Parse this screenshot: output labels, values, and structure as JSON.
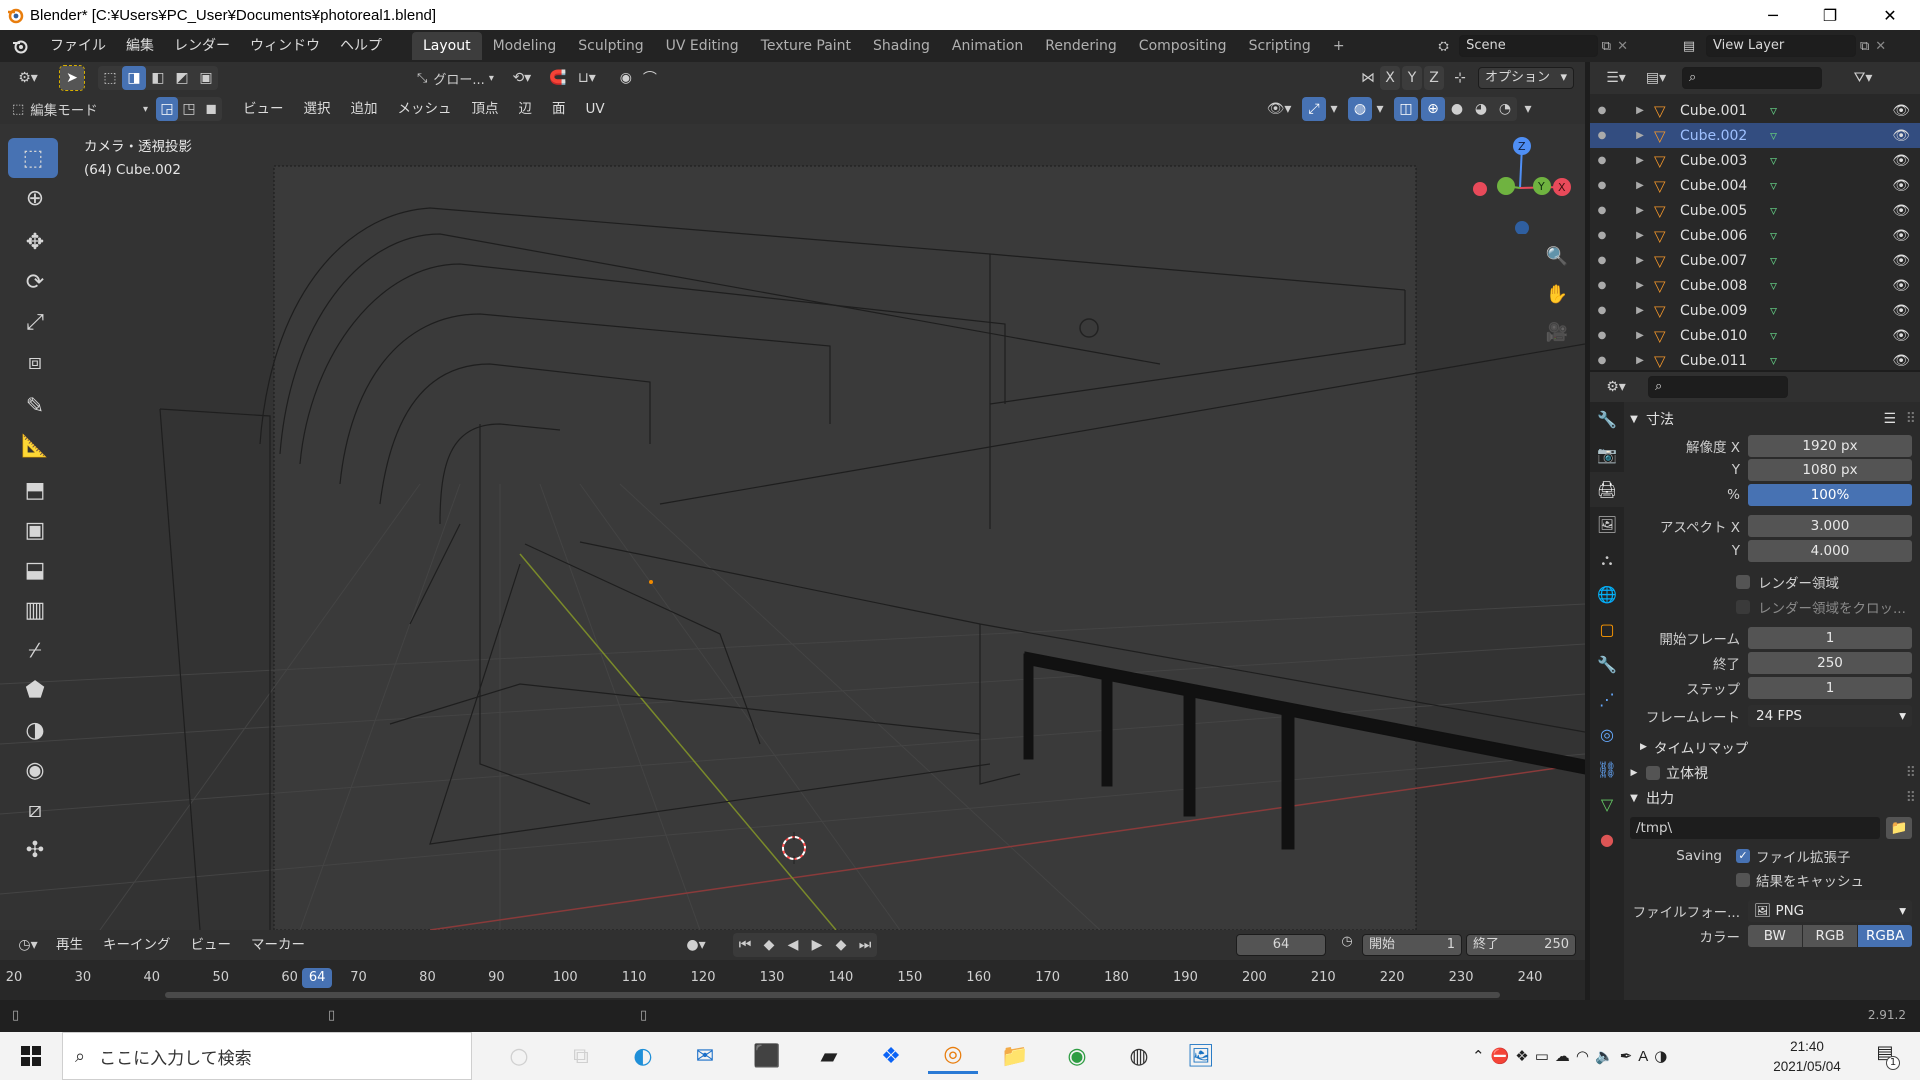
{
  "window": {
    "title": "Blender* [C:¥Users¥PC_User¥Documents¥photoreal1.blend]",
    "minimize": "─",
    "maximize": "❐",
    "close": "✕"
  },
  "menu": [
    "ファイル",
    "編集",
    "レンダー",
    "ウィンドウ",
    "ヘルプ"
  ],
  "workspaces": [
    "Layout",
    "Modeling",
    "Sculpting",
    "UV Editing",
    "Texture Paint",
    "Shading",
    "Animation",
    "Rendering",
    "Compositing",
    "Scripting"
  ],
  "workspace_add": "+",
  "scene": {
    "label": "Scene",
    "view_layer": "View Layer"
  },
  "viewport_header": {
    "transform_orientation": "グロー...",
    "options": "オプション",
    "axis_x": "X",
    "axis_y": "Y",
    "axis_z": "Z",
    "mode": "編集モード",
    "menus": [
      "ビュー",
      "選択",
      "追加",
      "メッシュ",
      "頂点",
      "辺",
      "面",
      "UV"
    ]
  },
  "viewport_info": {
    "line1": "カメラ・透視投影",
    "line2": "(64) Cube.002"
  },
  "gizmo": {
    "x": "X",
    "y": "Y",
    "z": "Z"
  },
  "outliner": {
    "items": [
      {
        "name": "Cube.001",
        "selected": false
      },
      {
        "name": "Cube.002",
        "selected": true
      },
      {
        "name": "Cube.003",
        "selected": false
      },
      {
        "name": "Cube.004",
        "selected": false
      },
      {
        "name": "Cube.005",
        "selected": false
      },
      {
        "name": "Cube.006",
        "selected": false
      },
      {
        "name": "Cube.007",
        "selected": false
      },
      {
        "name": "Cube.008",
        "selected": false
      },
      {
        "name": "Cube.009",
        "selected": false
      },
      {
        "name": "Cube.010",
        "selected": false
      },
      {
        "name": "Cube.011",
        "selected": false
      }
    ]
  },
  "properties": {
    "dimensions_title": "寸法",
    "res_x_label": "解像度 X",
    "res_x": "1920 px",
    "res_y_label": "Y",
    "res_y": "1080 px",
    "res_pct_label": "%",
    "res_pct": "100%",
    "aspect_x_label": "アスペクト X",
    "aspect_x": "3.000",
    "aspect_y_label": "Y",
    "aspect_y": "4.000",
    "render_region": "レンダー領域",
    "crop_region": "レンダー領域をクロッ...",
    "frame_start_label": "開始フレーム",
    "frame_start": "1",
    "frame_end_label": "終了",
    "frame_end": "250",
    "frame_step_label": "ステップ",
    "frame_step": "1",
    "fps_label": "フレームレート",
    "fps": "24 FPS",
    "time_remap": "タイムリマップ",
    "stereoscopy": "立体視",
    "output_title": "出力",
    "output_path": "/tmp\\",
    "saving_label": "Saving",
    "file_ext": "ファイル拡張子",
    "cache_result": "結果をキャッシュ",
    "file_format_label": "ファイルフォー...",
    "file_format": "PNG",
    "color_label": "カラー",
    "color_bw": "BW",
    "color_rgb": "RGB",
    "color_rgba": "RGBA"
  },
  "timeline": {
    "menus": [
      "再生",
      "キーイング",
      "ビュー",
      "マーカー"
    ],
    "current_frame": "64",
    "start_label": "開始",
    "start": "1",
    "end_label": "終了",
    "end": "250",
    "ticks": [
      "20",
      "30",
      "40",
      "50",
      "60",
      "70",
      "80",
      "90",
      "100",
      "110",
      "120",
      "130",
      "140",
      "150",
      "160",
      "170",
      "180",
      "190",
      "200",
      "210",
      "220",
      "230",
      "240"
    ],
    "playhead": "64"
  },
  "status": {
    "version": "2.91.2"
  },
  "taskbar": {
    "search_placeholder": "ここに入力して検索",
    "time": "21:40",
    "date": "2021/05/04",
    "ime": "A",
    "notif_count": "1"
  }
}
